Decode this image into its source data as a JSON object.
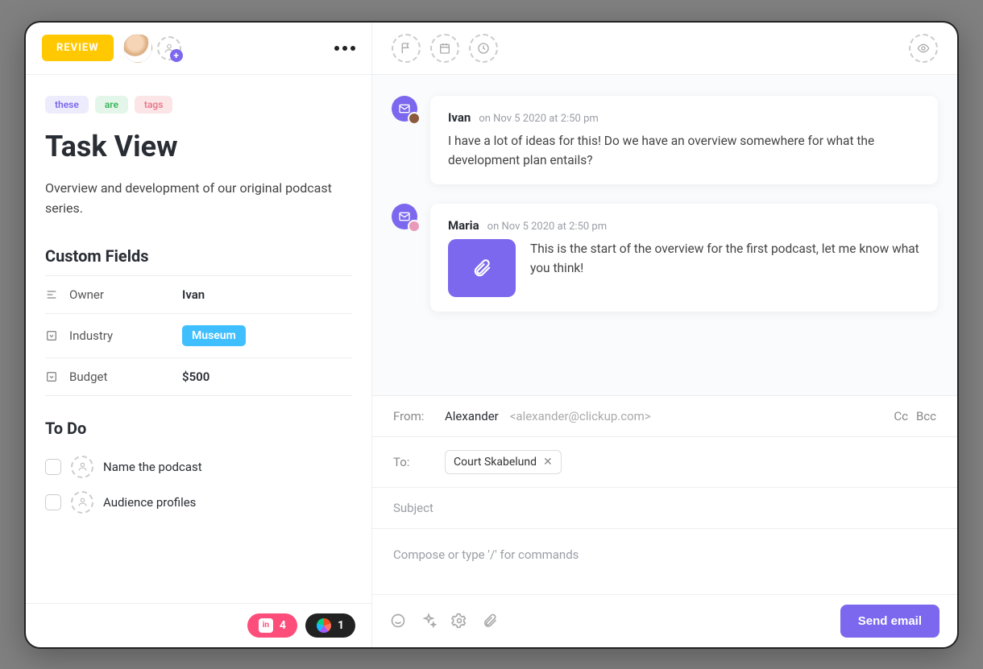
{
  "left": {
    "status_label": "REVIEW",
    "tags": [
      "these",
      "are",
      "tags"
    ],
    "title": "Task View",
    "description": "Overview and development of our original podcast series.",
    "custom_fields_heading": "Custom Fields",
    "fields": {
      "owner_label": "Owner",
      "owner_value": "Ivan",
      "industry_label": "Industry",
      "industry_value": "Museum",
      "budget_label": "Budget",
      "budget_value": "$500"
    },
    "todo_heading": "To Do",
    "todos": [
      "Name the podcast",
      "Audience profiles"
    ],
    "footer": {
      "invision_count": "4",
      "figma_count": "1"
    }
  },
  "thread": [
    {
      "author": "Ivan",
      "time": "on Nov 5 2020 at 2:50 pm",
      "text": "I have a lot of ideas for this! Do we have an overview somewhere for what the development plan entails?",
      "has_attachment": false,
      "avatar_color": "#8B5A3C"
    },
    {
      "author": "Maria",
      "time": "on Nov 5 2020 at 2:50 pm",
      "text": "This is the start of the overview for the first podcast, let me know what you think!",
      "has_attachment": true,
      "avatar_color": "#E89AB8"
    }
  ],
  "composer": {
    "from_label": "From:",
    "from_name": "Alexander",
    "from_email": "<alexander@clickup.com>",
    "cc_label": "Cc",
    "bcc_label": "Bcc",
    "to_label": "To:",
    "to_chip": "Court Skabelund",
    "subject_placeholder": "Subject",
    "body_placeholder": "Compose or type '/' for commands",
    "send_label": "Send email"
  }
}
